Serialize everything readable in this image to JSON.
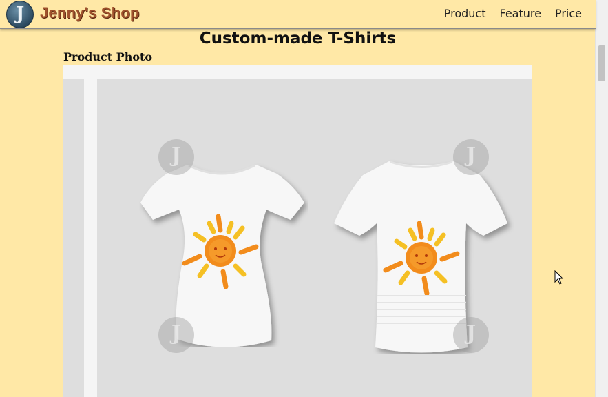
{
  "header": {
    "logo_letter": "J",
    "brand": "Jenny's Shop",
    "nav": [
      {
        "label": "Product"
      },
      {
        "label": "Feature"
      },
      {
        "label": "Price"
      }
    ]
  },
  "main": {
    "title": "Custom-made T-Shirts",
    "section_label": "Product Photo",
    "watermark_letter": "J"
  },
  "colors": {
    "page_bg": "#ffe8a6",
    "brand": "#a0522d",
    "sun_orange": "#f28c1c",
    "sun_yellow": "#f5c024"
  }
}
